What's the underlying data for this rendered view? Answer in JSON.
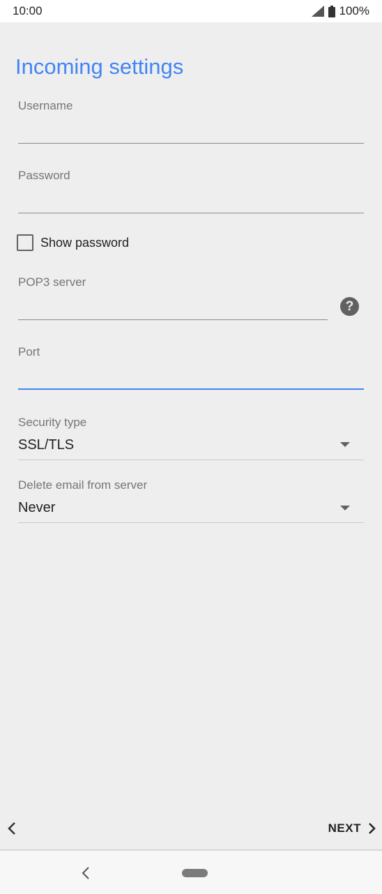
{
  "status_bar": {
    "time": "10:00",
    "battery": "100%",
    "icons": [
      "signal-icon",
      "battery-icon"
    ]
  },
  "page": {
    "title": "Incoming settings",
    "accent_color": "#4285f4"
  },
  "fields": {
    "username": {
      "label": "Username",
      "value": ""
    },
    "password": {
      "label": "Password",
      "value": ""
    },
    "show_password": {
      "label": "Show password",
      "checked": false
    },
    "pop3_server": {
      "label": "POP3 server",
      "value": "",
      "help_icon": "help-icon"
    },
    "port": {
      "label": "Port",
      "value": ""
    },
    "security_type": {
      "label": "Security type",
      "value": "SSL/TLS"
    },
    "delete_email": {
      "label": "Delete email from server",
      "value": "Never"
    }
  },
  "actions": {
    "next_label": "NEXT"
  }
}
